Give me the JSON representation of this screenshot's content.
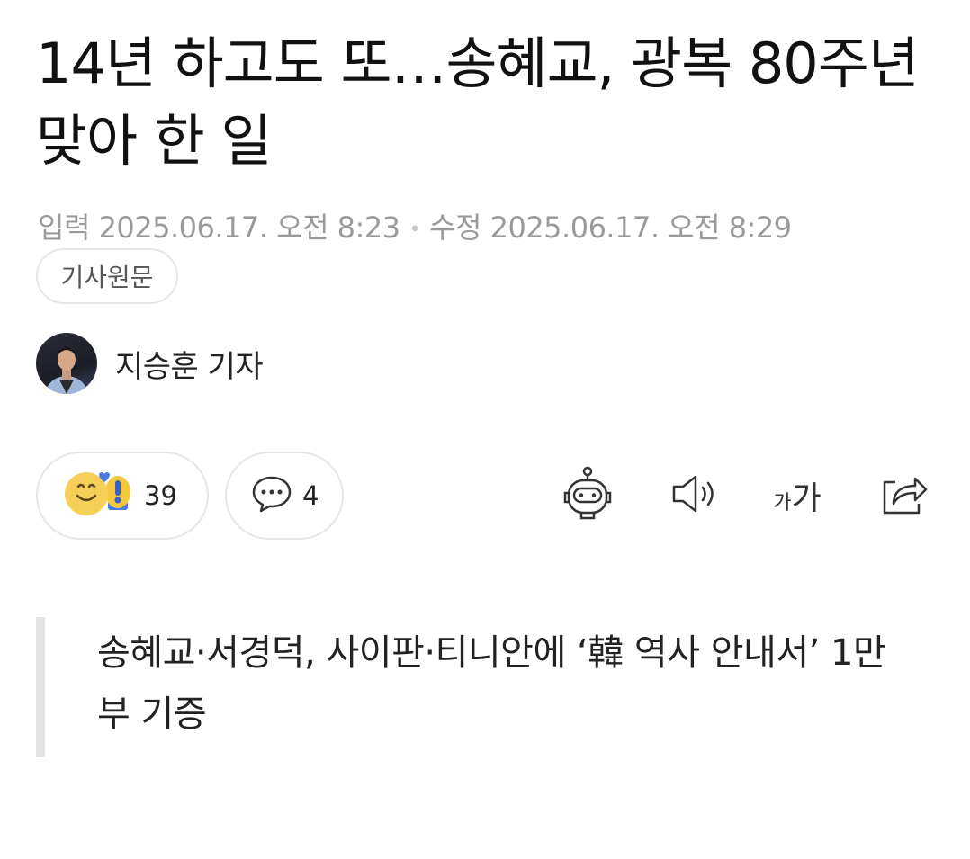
{
  "article": {
    "headline": "14년 하고도 또…송혜교, 광복 80주년 맞아 한 일",
    "published_label": "입력",
    "published": "2025.06.17. 오전 8:23",
    "modified_label": "수정",
    "modified": "2025.06.17. 오전 8:29",
    "origin_button": "기사원문",
    "reporter": "지승훈 기자"
  },
  "actions": {
    "reaction_count": "39",
    "comment_count": "4",
    "font_size_small": "가",
    "font_size_large": "가"
  },
  "summary": {
    "text": "송혜교·서경덕, 사이판·티니안에 ‘韓 역사 안내서’ 1만부 기증"
  },
  "icons": {
    "reaction": "emoji-reaction-icon",
    "comment": "comment-bubble-icon",
    "ai_summary": "robot-icon",
    "tts": "speaker-icon",
    "font_size": "font-size-icon",
    "share": "share-icon"
  }
}
